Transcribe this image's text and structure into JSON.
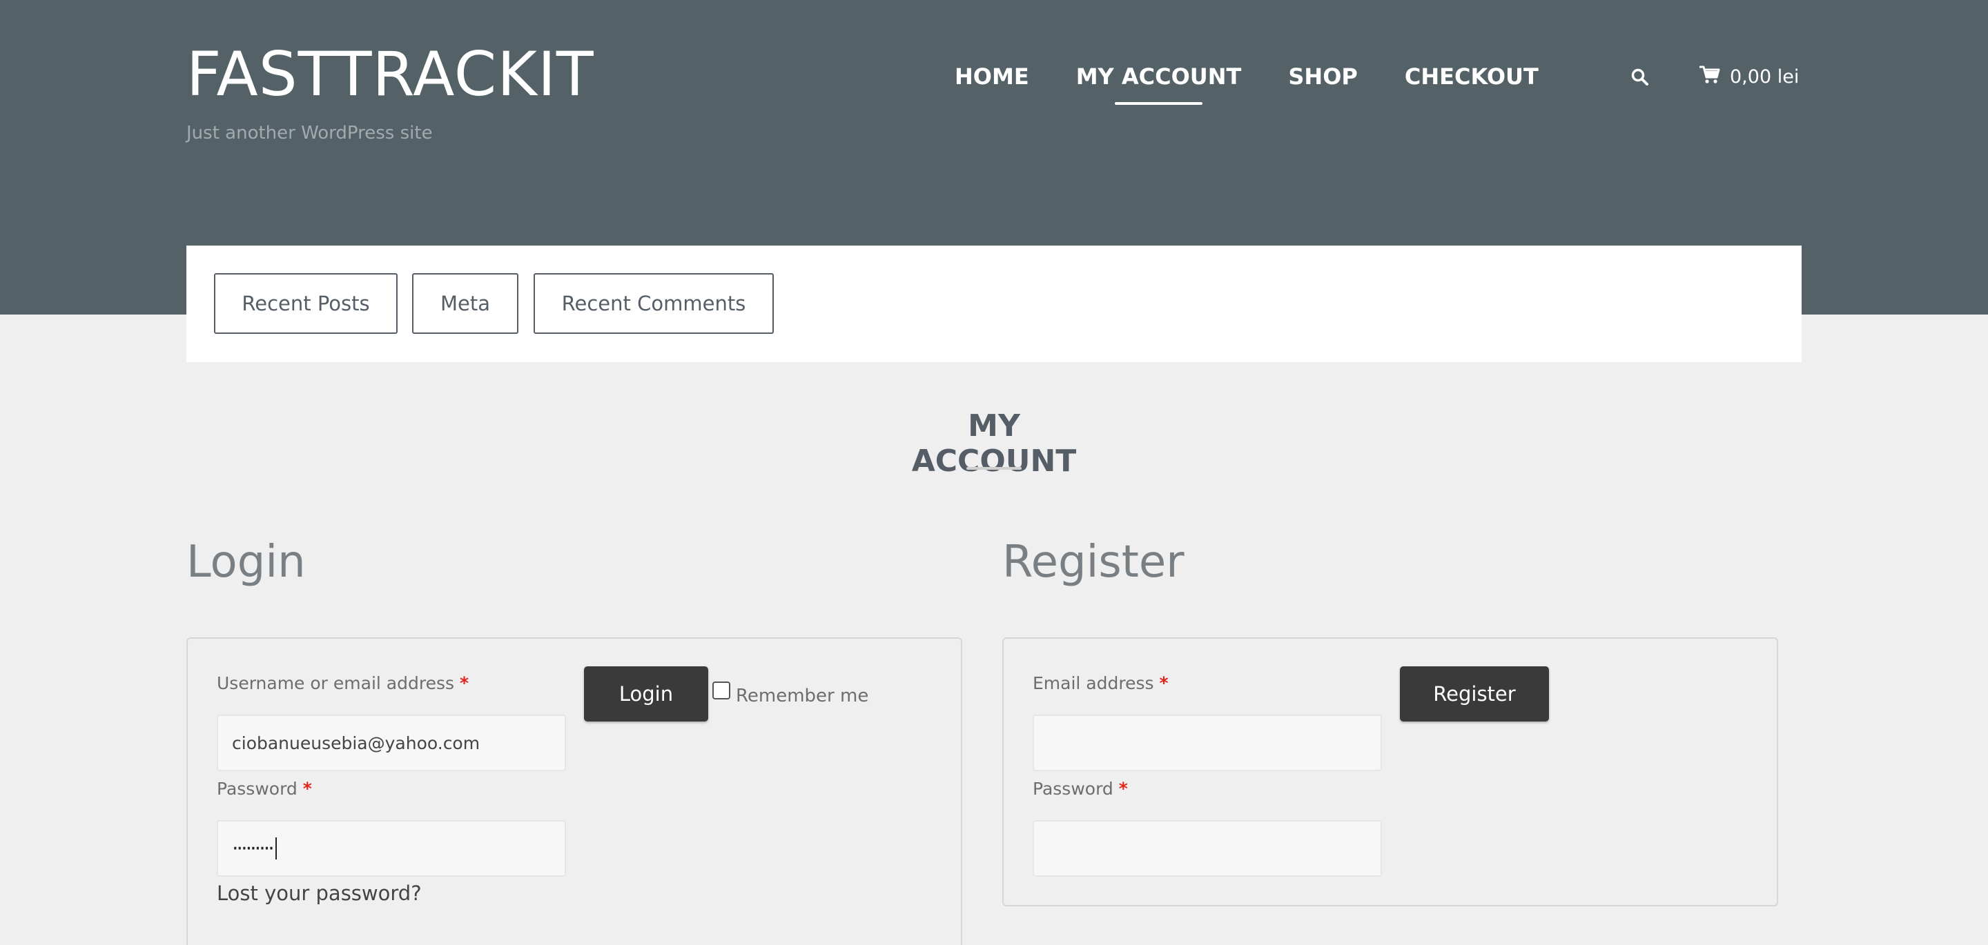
{
  "site": {
    "title": "FASTTRACKIT",
    "tagline": "Just another WordPress site"
  },
  "nav": {
    "items": [
      {
        "label": "HOME",
        "active": false
      },
      {
        "label": "MY ACCOUNT",
        "active": true
      },
      {
        "label": "SHOP",
        "active": false
      },
      {
        "label": "CHECKOUT",
        "active": false
      }
    ],
    "search_icon": "search-icon",
    "cart": {
      "icon": "cart-icon",
      "total": "0,00 lei"
    }
  },
  "widgets": {
    "tabs": [
      "Recent Posts",
      "Meta",
      "Recent Comments"
    ]
  },
  "page": {
    "title": "MY ACCOUNT"
  },
  "login": {
    "heading": "Login",
    "username_label": "Username or email address",
    "username_value": "ciobanueusebia@yahoo.com",
    "password_label": "Password",
    "password_masked": "·········",
    "required_mark": "*",
    "submit_label": "Login",
    "remember_label": "Remember me",
    "remember_checked": false,
    "lost_password": "Lost your password?"
  },
  "register": {
    "heading": "Register",
    "email_label": "Email address",
    "email_value": "",
    "password_label": "Password",
    "password_value": "",
    "required_mark": "*",
    "submit_label": "Register"
  },
  "colors": {
    "header_bg": "#546268",
    "accent_dark": "#3a3a3a",
    "required": "#e2231a",
    "page_bg": "#efefef"
  }
}
